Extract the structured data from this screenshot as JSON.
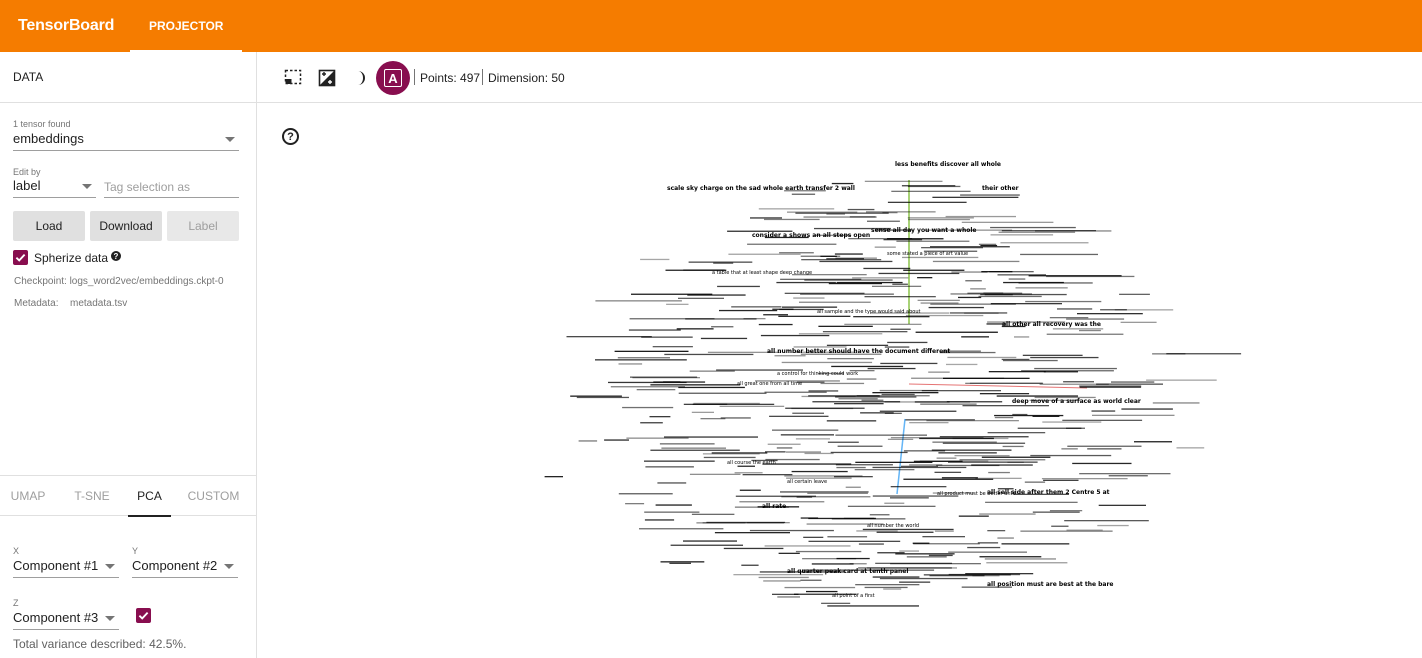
{
  "app": {
    "title": "TensorBoard",
    "active_tab": "PROJECTOR"
  },
  "colors": {
    "header": "#f57c00",
    "accent": "#880e4f"
  },
  "left": {
    "section_title": "DATA",
    "tensor_count_label": "1 tensor found",
    "tensor_selected": "embeddings",
    "edit_by_label": "Edit by",
    "edit_by_value": "label",
    "tag_placeholder": "Tag selection as",
    "buttons": {
      "load": "Load",
      "download": "Download",
      "label": "Label"
    },
    "spherize_label": "Spherize data",
    "spherize_checked": true,
    "checkpoint": "Checkpoint: logs_word2vec/embeddings.ckpt-0",
    "metadata_label": "Metadata:",
    "metadata_value": "metadata.tsv",
    "projection_tabs": [
      "UMAP",
      "T-SNE",
      "PCA",
      "CUSTOM"
    ],
    "active_projection": "PCA",
    "x_label": "X",
    "x_value": "Component #1",
    "y_label": "Y",
    "y_value": "Component #2",
    "z_label": "Z",
    "z_value": "Component #3",
    "z_checked": true,
    "variance": "Total variance described: 42.5%."
  },
  "toolbar": {
    "icons": [
      "selection-box-icon",
      "night-mode-contrast-icon",
      "moon-icon",
      "label-toggle-icon"
    ],
    "label_button_text": "A",
    "points": "Points: 497",
    "dimension": "Dimension: 50"
  },
  "canvas": {
    "help_text": "?",
    "labels": [
      "less benefits discover all whole",
      "scale sky charge on the sad whole earth transfer 2 wall",
      "their other",
      "consider a shows an all steps open",
      "sense all day you want a whole",
      "some stated a piece of art value",
      "a table that at least shape deep change",
      "all sample and the type would said about",
      "all other all recovery was the",
      "all number better should have the document different",
      "a control for thinking could work",
      "all great one from all time",
      "deep move of a surface as world clear",
      "all course the earth",
      "all certain leave",
      "all product must be better until",
      "all sell side after them 2 Centre 5 at",
      "all rate",
      "all number the world",
      "all quarter peak card at tenth panel",
      "all position must are best at the bare",
      "all point of a first"
    ]
  }
}
